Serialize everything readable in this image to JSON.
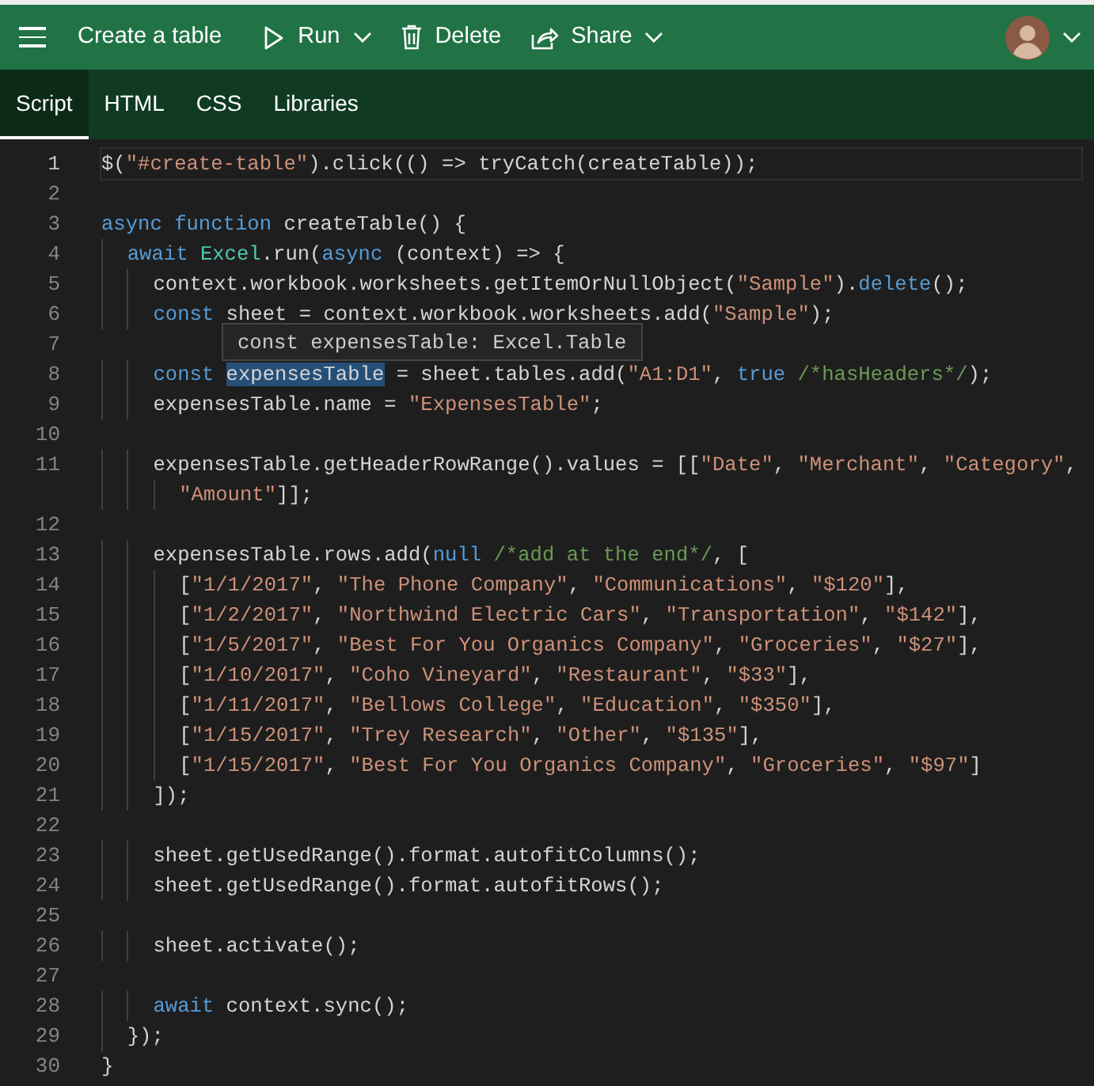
{
  "header": {
    "title": "Create a table",
    "actions": [
      {
        "kind": "run",
        "label": "Run",
        "dropdown": true
      },
      {
        "kind": "delete",
        "label": "Delete",
        "dropdown": false
      },
      {
        "kind": "share",
        "label": "Share",
        "dropdown": true
      }
    ]
  },
  "tabs": [
    {
      "label": "Script",
      "selected": true
    },
    {
      "label": "HTML",
      "selected": false
    },
    {
      "label": "CSS",
      "selected": false
    },
    {
      "label": "Libraries",
      "selected": false
    }
  ],
  "editor": {
    "tooltip": {
      "text": "const expensesTable: Excel.Table"
    },
    "lines": [
      {
        "number": "1",
        "active": true,
        "tokens": [
          {
            "kind": "plain",
            "text": "$("
          },
          {
            "kind": "string",
            "text": "\"#create-table\""
          },
          {
            "kind": "plain",
            "text": ").click(() => tryCatch(createTable));"
          }
        ]
      },
      {
        "number": "2",
        "active": false
      },
      {
        "number": "3",
        "active": false,
        "tokens": [
          {
            "kind": "keyword",
            "text": "async function"
          },
          {
            "kind": "plain",
            "text": " createTable() {"
          }
        ]
      },
      {
        "number": "4",
        "active": false,
        "tokens": [
          {
            "kind": "keyword",
            "text": "  await"
          },
          {
            "kind": "type",
            "text": " Excel"
          },
          {
            "kind": "plain",
            "text": ".run("
          },
          {
            "kind": "keyword",
            "text": "async"
          },
          {
            "kind": "plain",
            "text": " (context) => {"
          }
        ]
      },
      {
        "number": "5",
        "active": false,
        "tokens": [
          {
            "kind": "plain",
            "text": "    context.workbook.worksheets.getItemOrNullObject("
          },
          {
            "kind": "string",
            "text": "\"Sample\""
          },
          {
            "kind": "plain",
            "text": ")."
          },
          {
            "kind": "keyword",
            "text": "delete"
          },
          {
            "kind": "plain",
            "text": "();"
          }
        ]
      },
      {
        "number": "6",
        "active": false,
        "tokens": [
          {
            "kind": "keyword",
            "text": "    const"
          },
          {
            "kind": "plain",
            "text": " sheet = context.workbook.worksheets.add("
          },
          {
            "kind": "string",
            "text": "\"Sample\""
          },
          {
            "kind": "plain",
            "text": ");"
          }
        ]
      },
      {
        "number": "7",
        "active": false
      },
      {
        "number": "8",
        "active": false,
        "tokens": [
          {
            "kind": "keyword",
            "text": "    const "
          },
          {
            "kind": "selected",
            "text": "expensesTable"
          },
          {
            "kind": "plain",
            "text": " = sheet.tables.add("
          },
          {
            "kind": "string",
            "text": "\"A1:D1\""
          },
          {
            "kind": "plain",
            "text": ", "
          },
          {
            "kind": "keyword",
            "text": "true"
          },
          {
            "kind": "comment",
            "text": " /*hasHeaders*/"
          },
          {
            "kind": "plain",
            "text": ");"
          }
        ]
      },
      {
        "number": "9",
        "active": false,
        "tokens": [
          {
            "kind": "plain",
            "text": "    expensesTable.name = "
          },
          {
            "kind": "string",
            "text": "\"ExpensesTable\""
          },
          {
            "kind": "plain",
            "text": ";"
          }
        ]
      },
      {
        "number": "10",
        "active": false
      },
      {
        "number": "11",
        "active": false,
        "tokens": [
          {
            "kind": "plain",
            "text": "    expensesTable.getHeaderRowRange().values = [["
          },
          {
            "kind": "string",
            "text": "\"Date\""
          },
          {
            "kind": "plain",
            "text": ", "
          },
          {
            "kind": "string",
            "text": "\"Merchant\""
          },
          {
            "kind": "plain",
            "text": ", "
          },
          {
            "kind": "string",
            "text": "\"Category\""
          },
          {
            "kind": "plain",
            "text": ","
          }
        ],
        "continuation": [
          {
            "kind": "string",
            "text": "      \"Amount\""
          },
          {
            "kind": "plain",
            "text": "]];"
          }
        ]
      },
      {
        "number": "12",
        "active": false
      },
      {
        "number": "13",
        "active": false,
        "tokens": [
          {
            "kind": "plain",
            "text": "    expensesTable.rows.add("
          },
          {
            "kind": "keyword",
            "text": "null"
          },
          {
            "kind": "comment",
            "text": " /*add at the end*/"
          },
          {
            "kind": "plain",
            "text": ", ["
          }
        ]
      },
      {
        "number": "14",
        "active": false,
        "tokens": [
          {
            "kind": "plain",
            "text": "      ["
          },
          {
            "kind": "string",
            "text": "\"1/1/2017\""
          },
          {
            "kind": "plain",
            "text": ", "
          },
          {
            "kind": "string",
            "text": "\"The Phone Company\""
          },
          {
            "kind": "plain",
            "text": ", "
          },
          {
            "kind": "string",
            "text": "\"Communications\""
          },
          {
            "kind": "plain",
            "text": ", "
          },
          {
            "kind": "string",
            "text": "\"$120\""
          },
          {
            "kind": "plain",
            "text": "],"
          }
        ]
      },
      {
        "number": "15",
        "active": false,
        "tokens": [
          {
            "kind": "plain",
            "text": "      ["
          },
          {
            "kind": "string",
            "text": "\"1/2/2017\""
          },
          {
            "kind": "plain",
            "text": ", "
          },
          {
            "kind": "string",
            "text": "\"Northwind Electric Cars\""
          },
          {
            "kind": "plain",
            "text": ", "
          },
          {
            "kind": "string",
            "text": "\"Transportation\""
          },
          {
            "kind": "plain",
            "text": ", "
          },
          {
            "kind": "string",
            "text": "\"$142\""
          },
          {
            "kind": "plain",
            "text": "],"
          }
        ]
      },
      {
        "number": "16",
        "active": false,
        "tokens": [
          {
            "kind": "plain",
            "text": "      ["
          },
          {
            "kind": "string",
            "text": "\"1/5/2017\""
          },
          {
            "kind": "plain",
            "text": ", "
          },
          {
            "kind": "string",
            "text": "\"Best For You Organics Company\""
          },
          {
            "kind": "plain",
            "text": ", "
          },
          {
            "kind": "string",
            "text": "\"Groceries\""
          },
          {
            "kind": "plain",
            "text": ", "
          },
          {
            "kind": "string",
            "text": "\"$27\""
          },
          {
            "kind": "plain",
            "text": "],"
          }
        ]
      },
      {
        "number": "17",
        "active": false,
        "tokens": [
          {
            "kind": "plain",
            "text": "      ["
          },
          {
            "kind": "string",
            "text": "\"1/10/2017\""
          },
          {
            "kind": "plain",
            "text": ", "
          },
          {
            "kind": "string",
            "text": "\"Coho Vineyard\""
          },
          {
            "kind": "plain",
            "text": ", "
          },
          {
            "kind": "string",
            "text": "\"Restaurant\""
          },
          {
            "kind": "plain",
            "text": ", "
          },
          {
            "kind": "string",
            "text": "\"$33\""
          },
          {
            "kind": "plain",
            "text": "],"
          }
        ]
      },
      {
        "number": "18",
        "active": false,
        "tokens": [
          {
            "kind": "plain",
            "text": "      ["
          },
          {
            "kind": "string",
            "text": "\"1/11/2017\""
          },
          {
            "kind": "plain",
            "text": ", "
          },
          {
            "kind": "string",
            "text": "\"Bellows College\""
          },
          {
            "kind": "plain",
            "text": ", "
          },
          {
            "kind": "string",
            "text": "\"Education\""
          },
          {
            "kind": "plain",
            "text": ", "
          },
          {
            "kind": "string",
            "text": "\"$350\""
          },
          {
            "kind": "plain",
            "text": "],"
          }
        ]
      },
      {
        "number": "19",
        "active": false,
        "tokens": [
          {
            "kind": "plain",
            "text": "      ["
          },
          {
            "kind": "string",
            "text": "\"1/15/2017\""
          },
          {
            "kind": "plain",
            "text": ", "
          },
          {
            "kind": "string",
            "text": "\"Trey Research\""
          },
          {
            "kind": "plain",
            "text": ", "
          },
          {
            "kind": "string",
            "text": "\"Other\""
          },
          {
            "kind": "plain",
            "text": ", "
          },
          {
            "kind": "string",
            "text": "\"$135\""
          },
          {
            "kind": "plain",
            "text": "],"
          }
        ]
      },
      {
        "number": "20",
        "active": false,
        "tokens": [
          {
            "kind": "plain",
            "text": "      ["
          },
          {
            "kind": "string",
            "text": "\"1/15/2017\""
          },
          {
            "kind": "plain",
            "text": ", "
          },
          {
            "kind": "string",
            "text": "\"Best For You Organics Company\""
          },
          {
            "kind": "plain",
            "text": ", "
          },
          {
            "kind": "string",
            "text": "\"Groceries\""
          },
          {
            "kind": "plain",
            "text": ", "
          },
          {
            "kind": "string",
            "text": "\"$97\""
          },
          {
            "kind": "plain",
            "text": "]"
          }
        ]
      },
      {
        "number": "21",
        "active": false,
        "tokens": [
          {
            "kind": "plain",
            "text": "    ]);"
          }
        ]
      },
      {
        "number": "22",
        "active": false
      },
      {
        "number": "23",
        "active": false,
        "tokens": [
          {
            "kind": "plain",
            "text": "    sheet.getUsedRange().format.autofitColumns();"
          }
        ]
      },
      {
        "number": "24",
        "active": false,
        "tokens": [
          {
            "kind": "plain",
            "text": "    sheet.getUsedRange().format.autofitRows();"
          }
        ]
      },
      {
        "number": "25",
        "active": false
      },
      {
        "number": "26",
        "active": false,
        "tokens": [
          {
            "kind": "plain",
            "text": "    sheet.activate();"
          }
        ]
      },
      {
        "number": "27",
        "active": false
      },
      {
        "number": "28",
        "active": false,
        "tokens": [
          {
            "kind": "keyword",
            "text": "    await"
          },
          {
            "kind": "plain",
            "text": " context.sync();"
          }
        ]
      },
      {
        "number": "29",
        "active": false,
        "tokens": [
          {
            "kind": "plain",
            "text": "  });"
          }
        ]
      },
      {
        "number": "30",
        "active": false,
        "tokens": [
          {
            "kind": "plain",
            "text": "}"
          }
        ]
      }
    ]
  }
}
